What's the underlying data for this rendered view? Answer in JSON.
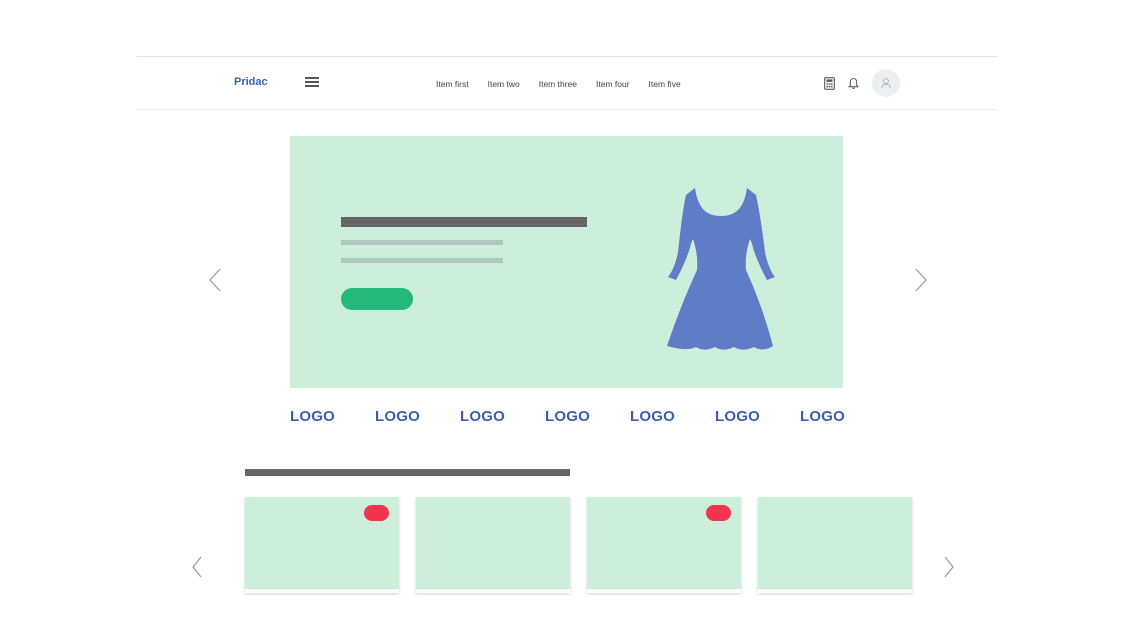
{
  "header": {
    "brand": "Pridac",
    "menu_icon": "hamburger-menu-icon",
    "nav": [
      {
        "label": "Item first"
      },
      {
        "label": "Item two"
      },
      {
        "label": "Item three"
      },
      {
        "label": "Item four"
      },
      {
        "label": "Item five"
      }
    ],
    "actions": {
      "calculator_icon": "calculator-icon",
      "bell_icon": "bell-icon",
      "avatar_icon": "user-icon"
    }
  },
  "hero": {
    "background": "#cdeedb",
    "cta_color": "#24b87a",
    "image_icon": "dress-icon",
    "image_color": "#5f7dc7"
  },
  "logos": [
    "LOGO",
    "LOGO",
    "LOGO",
    "LOGO",
    "LOGO",
    "LOGO",
    "LOGO"
  ],
  "products": {
    "cards": [
      {
        "badge": true
      },
      {
        "badge": false
      },
      {
        "badge": true
      },
      {
        "badge": false
      }
    ],
    "badge_color": "#f2354f"
  },
  "colors": {
    "brand": "#3b5fb0",
    "placeholder_bar": "#666666",
    "card_bg": "#cdeedb"
  }
}
